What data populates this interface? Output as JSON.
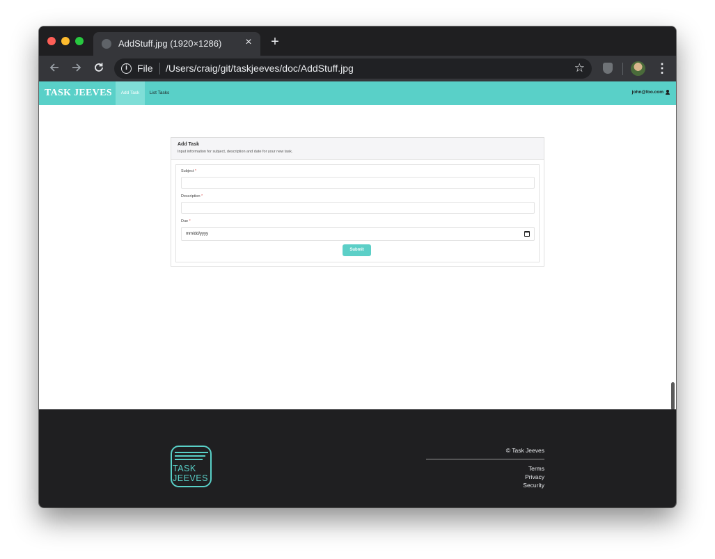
{
  "browser": {
    "tab_title": "AddStuff.jpg (1920×1286)",
    "tab_close": "×",
    "new_tab": "+",
    "url_scheme": "File",
    "url_path": "/Users/craig/git/taskjeeves/doc/AddStuff.jpg",
    "icons": {
      "back": "arrow-left-icon",
      "forward": "arrow-right-icon",
      "reload": "reload-icon",
      "info": "info-icon",
      "star": "star-icon",
      "menu": "kebab-menu-icon"
    }
  },
  "app": {
    "brand": "TASK JEEVES",
    "nav": [
      {
        "label": "Add Task",
        "active": true
      },
      {
        "label": "List Tasks",
        "active": false
      }
    ],
    "user_email": "john@foo.com",
    "accent_color": "#59d0c8"
  },
  "form": {
    "title": "Add Task",
    "subtitle": "Input information for subject, description and date for your new task.",
    "fields": [
      {
        "label": "Subject",
        "required_mark": "*",
        "value": ""
      },
      {
        "label": "Description",
        "required_mark": "*",
        "value": ""
      },
      {
        "label": "Due",
        "required_mark": "*",
        "value": "mm/dd/yyyy"
      }
    ],
    "submit_label": "Submit"
  },
  "footer": {
    "logo_line1": "TASK",
    "logo_line2": "JEEVES",
    "copyright": "© Task Jeeves",
    "links": [
      "Terms",
      "Privacy",
      "Security"
    ]
  }
}
